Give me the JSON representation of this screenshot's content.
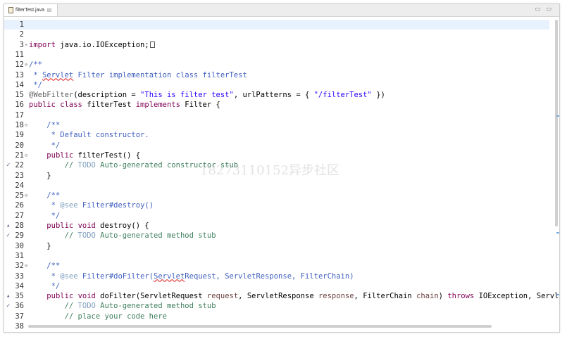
{
  "tab": {
    "filename": "filterTest.java",
    "close": "☒"
  },
  "window_buttons": "▭ ▭",
  "watermark": "18273110152异步社区",
  "lines": [
    {
      "num": "1",
      "code": ""
    },
    {
      "num": "2",
      "code": ""
    },
    {
      "num": "3",
      "code": "import java.io.IOException;"
    },
    {
      "num": "11",
      "code": ""
    },
    {
      "num": "12",
      "code": "/**"
    },
    {
      "num": "13",
      "code": " * Servlet Filter implementation class filterTest"
    },
    {
      "num": "14",
      "code": " */"
    },
    {
      "num": "15",
      "code": "@WebFilter(description = \"This is filter test\", urlPatterns = { \"/filterTest\" })"
    },
    {
      "num": "16",
      "code": "public class filterTest implements Filter {"
    },
    {
      "num": "17",
      "code": ""
    },
    {
      "num": "18",
      "code": "    /**"
    },
    {
      "num": "19",
      "code": "     * Default constructor."
    },
    {
      "num": "20",
      "code": "     */"
    },
    {
      "num": "21",
      "code": "    public filterTest() {"
    },
    {
      "num": "22",
      "code": "        // TODO Auto-generated constructor stub"
    },
    {
      "num": "23",
      "code": "    }"
    },
    {
      "num": "24",
      "code": ""
    },
    {
      "num": "25",
      "code": "    /**"
    },
    {
      "num": "26",
      "code": "     * @see Filter#destroy()"
    },
    {
      "num": "27",
      "code": "     */"
    },
    {
      "num": "28",
      "code": "    public void destroy() {"
    },
    {
      "num": "29",
      "code": "        // TODO Auto-generated method stub"
    },
    {
      "num": "30",
      "code": "    }"
    },
    {
      "num": "31",
      "code": ""
    },
    {
      "num": "32",
      "code": "    /**"
    },
    {
      "num": "33",
      "code": "     * @see Filter#doFilter(ServletRequest, ServletResponse, FilterChain)"
    },
    {
      "num": "34",
      "code": "     */"
    },
    {
      "num": "35",
      "code": "    public void doFilter(ServletRequest request, ServletResponse response, FilterChain chain) throws IOException, Servle"
    },
    {
      "num": "36",
      "code": "        // TODO Auto-generated method stub"
    },
    {
      "num": "37",
      "code": "        // place your code here"
    },
    {
      "num": "38",
      "code": ""
    }
  ]
}
